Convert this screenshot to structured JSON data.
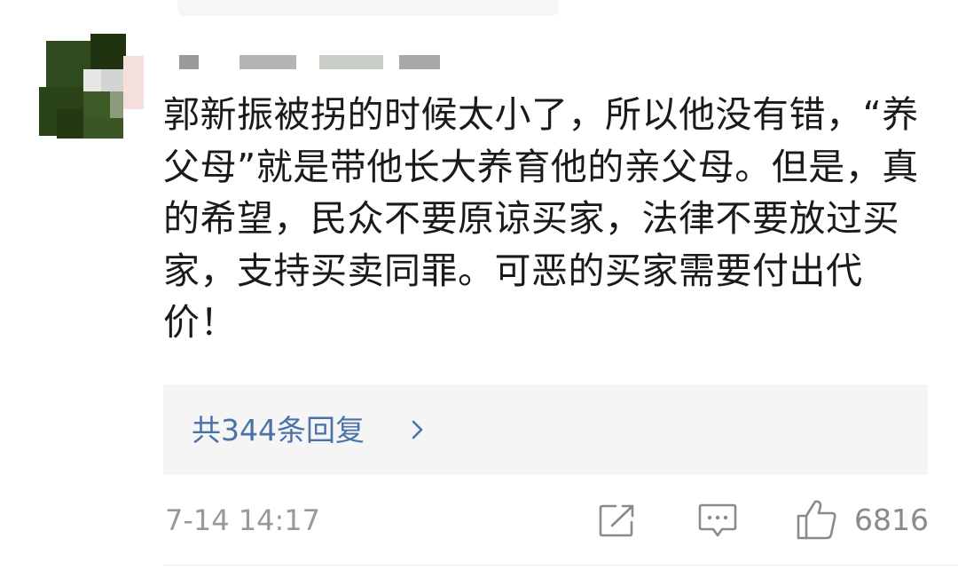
{
  "comment": {
    "text": "郭新振被拐的时候太小了，所以他没有错，“养父母”就是带他长大养育他的亲父母。但是，真的希望，民众不要原谅买家，法律不要放过买家，支持买卖同罪。可恶的买家需要付出代价！",
    "replies_label": "共344条回复",
    "timestamp": "7-14 14:17",
    "like_count": "6816"
  },
  "icons": {
    "share": "share-icon",
    "reply": "comment-icon",
    "like": "thumbs-up-icon",
    "chevron": "chevron-right-icon"
  },
  "colors": {
    "link": "#4a72a9",
    "meta": "#999999",
    "text": "#1a1a1a",
    "reply_box_bg": "#f5f5f5"
  }
}
